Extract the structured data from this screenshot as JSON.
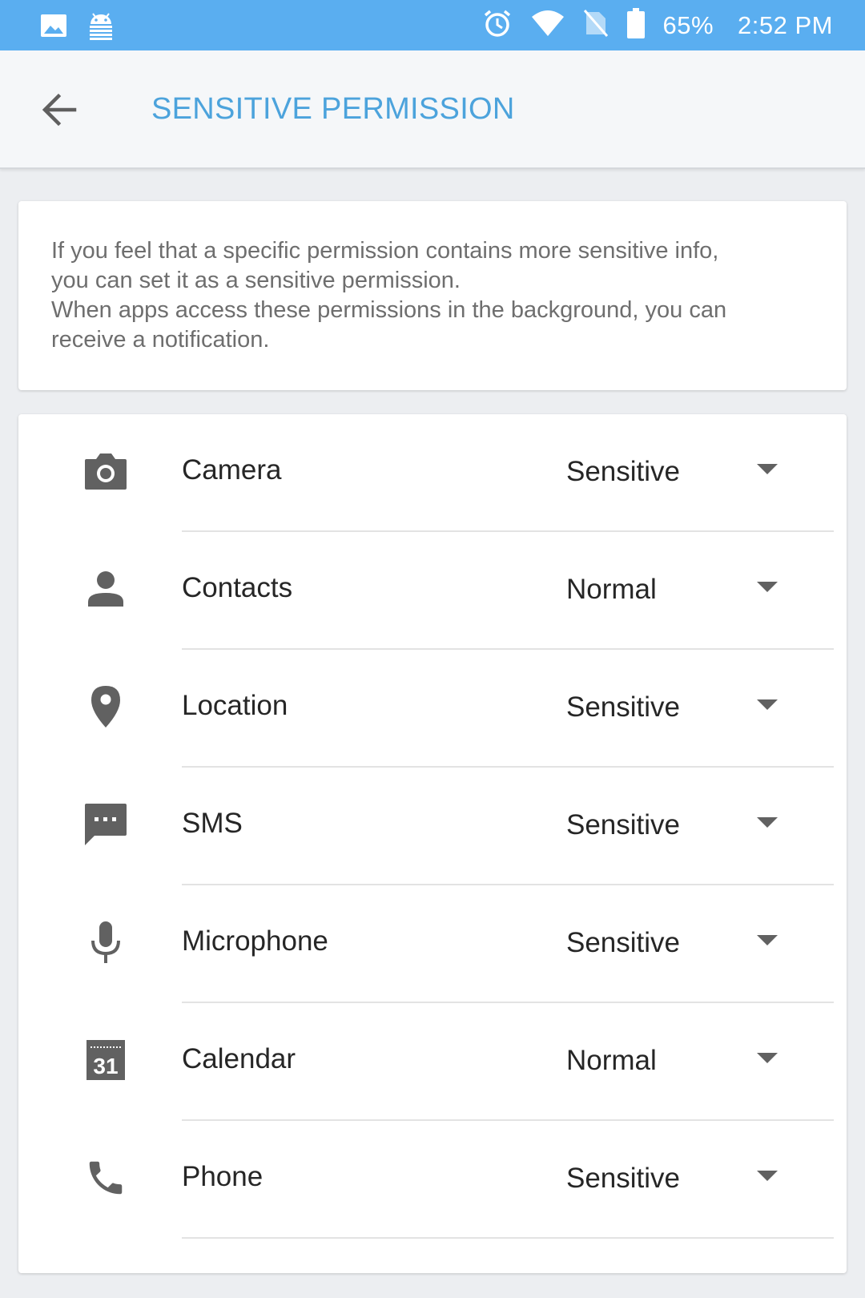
{
  "status_bar": {
    "battery_percent": "65%",
    "time": "2:52 PM",
    "icons": [
      "gallery-icon",
      "android-debug-icon",
      "alarm-icon",
      "wifi-icon",
      "no-sim-icon",
      "battery-icon"
    ]
  },
  "app_bar": {
    "back_icon": "back-arrow-icon",
    "title": "SENSITIVE PERMISSION",
    "title_color": "#4ca3dc"
  },
  "info": {
    "line1": "If you feel that a specific permission contains more sensitive info,",
    "line2": "you can set it as a sensitive permission.",
    "line3": "When apps access these permissions in the background, you can",
    "line4": "receive a notification."
  },
  "permissions": [
    {
      "icon": "camera-icon",
      "label": "Camera",
      "value": "Sensitive"
    },
    {
      "icon": "contacts-icon",
      "label": "Contacts",
      "value": "Normal"
    },
    {
      "icon": "location-icon",
      "label": "Location",
      "value": "Sensitive"
    },
    {
      "icon": "sms-icon",
      "label": "SMS",
      "value": "Sensitive"
    },
    {
      "icon": "microphone-icon",
      "label": "Microphone",
      "value": "Sensitive"
    },
    {
      "icon": "calendar-icon",
      "label": "Calendar",
      "value": "Normal",
      "calendar_day": "31"
    },
    {
      "icon": "phone-icon",
      "label": "Phone",
      "value": "Sensitive"
    }
  ],
  "colors": {
    "status_bar": "#5aaef0",
    "icon_gray": "#616161"
  }
}
